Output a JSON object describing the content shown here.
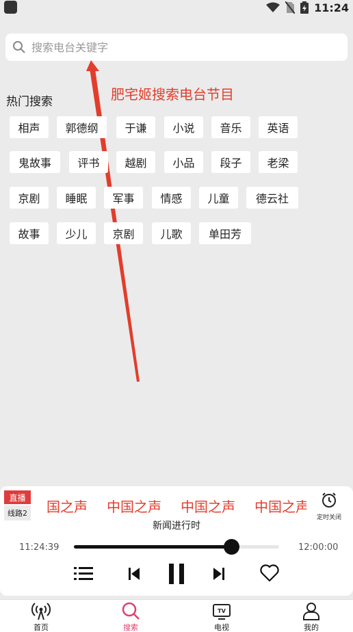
{
  "status_bar": {
    "time": "11:24"
  },
  "search": {
    "placeholder": "搜索电台关键字"
  },
  "annotation": {
    "text": "肥宅姬搜索电台节目"
  },
  "hot": {
    "title": "热门搜索",
    "rows": [
      [
        "相声",
        "郭德纲",
        "于谦",
        "小说",
        "音乐",
        "英语"
      ],
      [
        "鬼故事",
        "评书",
        "越剧",
        "小品",
        "段子",
        "老梁"
      ],
      [
        "京剧",
        "睡眠",
        "军事",
        "情感",
        "儿童",
        "德云社"
      ],
      [
        "故事",
        "少儿",
        "京剧",
        "儿歌",
        "单田芳"
      ]
    ]
  },
  "player": {
    "live_label": "直播",
    "line_label": "线路2",
    "marquee": [
      "国之声",
      "中国之声",
      "中国之声",
      "中国之声"
    ],
    "timer_label": "定时关闭",
    "program": "新闻进行时",
    "time_start": "11:24:39",
    "time_end": "12:00:00",
    "progress": 0.765
  },
  "tabs": [
    {
      "label": "首页",
      "icon": "broadcast-icon"
    },
    {
      "label": "搜索",
      "icon": "search-icon"
    },
    {
      "label": "电视",
      "icon": "tv-icon"
    },
    {
      "label": "我的",
      "icon": "user-icon"
    }
  ],
  "colors": {
    "accent": "#e23d2c",
    "active_tab": "#e23d6c",
    "background": "#ebebeb"
  }
}
